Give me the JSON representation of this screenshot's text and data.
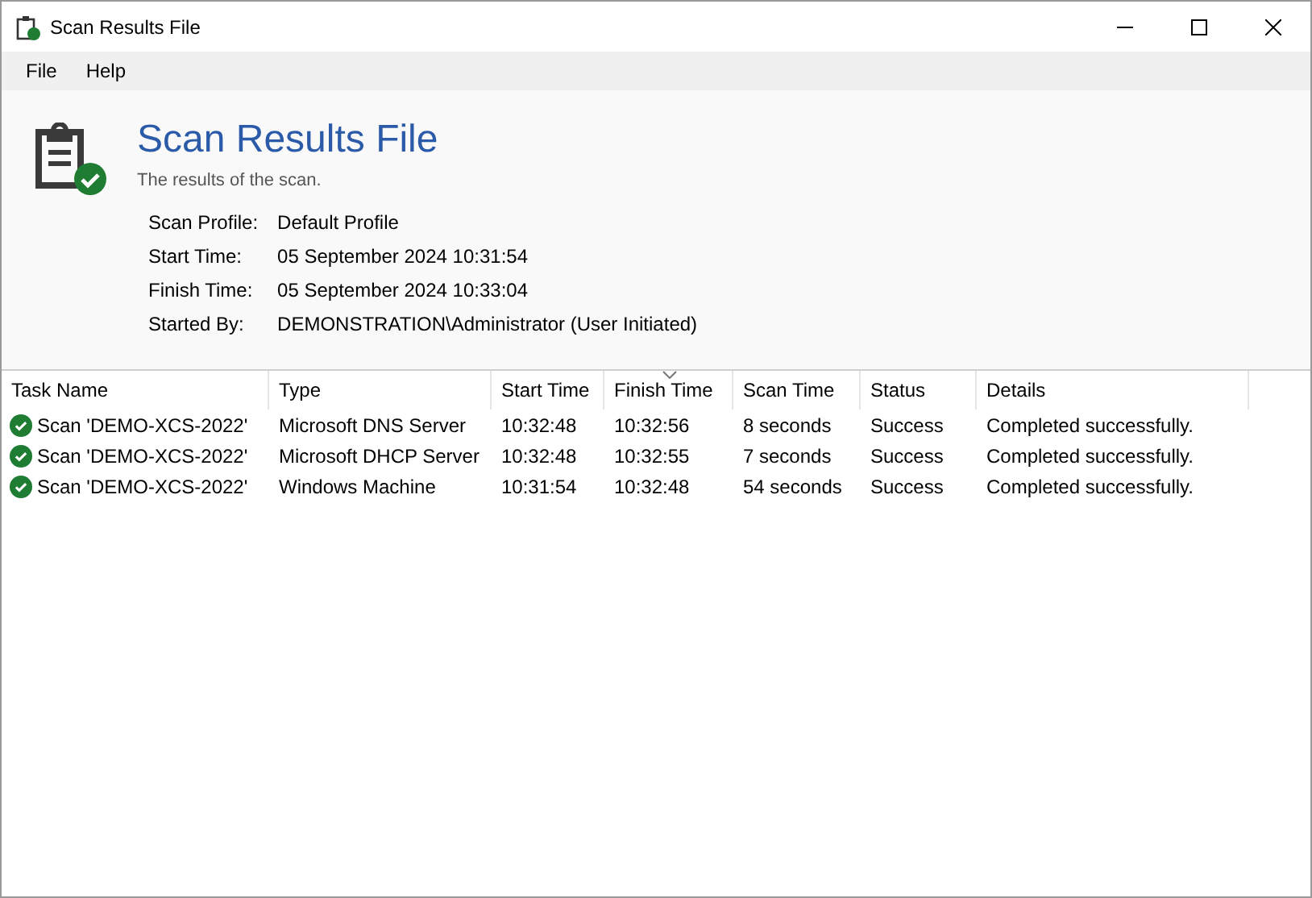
{
  "window": {
    "title": "Scan Results File"
  },
  "menu": [
    "File",
    "Help"
  ],
  "header": {
    "title": "Scan Results File",
    "subtitle": "The results of the scan.",
    "fields": [
      {
        "label": "Scan Profile:",
        "value": "Default Profile"
      },
      {
        "label": "Start Time:",
        "value": "05 September 2024 10:31:54"
      },
      {
        "label": "Finish Time:",
        "value": "05 September 2024 10:33:04"
      },
      {
        "label": "Started By:",
        "value": "DEMONSTRATION\\Administrator (User Initiated)"
      }
    ]
  },
  "table": {
    "columns": [
      {
        "label": "Task Name",
        "sorted": false
      },
      {
        "label": "Type",
        "sorted": false
      },
      {
        "label": "Start Time",
        "sorted": false
      },
      {
        "label": "Finish Time",
        "sorted": true
      },
      {
        "label": "Scan Time",
        "sorted": false
      },
      {
        "label": "Status",
        "sorted": false
      },
      {
        "label": "Details",
        "sorted": false
      }
    ],
    "rows": [
      {
        "kind": "success",
        "cells": [
          "Scan 'DEMO-XCS-2022'",
          "Microsoft DNS Server",
          "10:32:48",
          "10:32:56",
          "8 seconds",
          "Success",
          "Completed successfully."
        ]
      },
      {
        "kind": "success",
        "cells": [
          "Scan 'DEMO-XCS-2022'",
          "Microsoft DHCP Server",
          "10:32:48",
          "10:32:55",
          "7 seconds",
          "Success",
          "Completed successfully."
        ]
      },
      {
        "kind": "success",
        "cells": [
          "Scan 'DEMO-XCS-2022'",
          "Windows Machine",
          "10:31:54",
          "10:32:48",
          "54 seconds",
          "Success",
          "Completed successfully."
        ]
      }
    ]
  }
}
